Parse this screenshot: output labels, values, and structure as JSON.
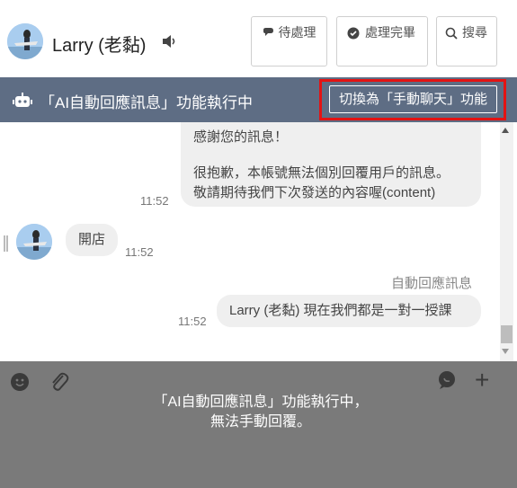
{
  "header": {
    "contact_name": "Larry (老黏)",
    "buttons": {
      "pending": "待處理",
      "done": "處理完畢",
      "search": "搜尋"
    }
  },
  "banner": {
    "status_text": "「AI自動回應訊息」功能執行中",
    "switch_button": "切換為「手動聊天」功能"
  },
  "messages": [
    {
      "side": "outgoing",
      "lines": [
        "感謝您的訊息！",
        "很抱歉，本帳號無法個別回覆用戶的訊息。",
        "敬請期待我們下次發送的內容喔(content)"
      ],
      "time": "11:52"
    },
    {
      "side": "incoming",
      "text": "開店",
      "time": "11:52"
    },
    {
      "side": "outgoing",
      "label": "自動回應訊息",
      "text": "Larry (老黏) 現在我們都是一對一授課",
      "time": "11:52"
    }
  ],
  "input": {
    "overlay_line1": "「AI自動回應訊息」功能執行中，",
    "overlay_line2": "無法手動回覆。"
  },
  "colors": {
    "banner_bg": "#5e6d84",
    "highlight_border": "#e31313",
    "input_overlay_bg": "#7a7a7a",
    "bubble_bg": "#efefef"
  }
}
